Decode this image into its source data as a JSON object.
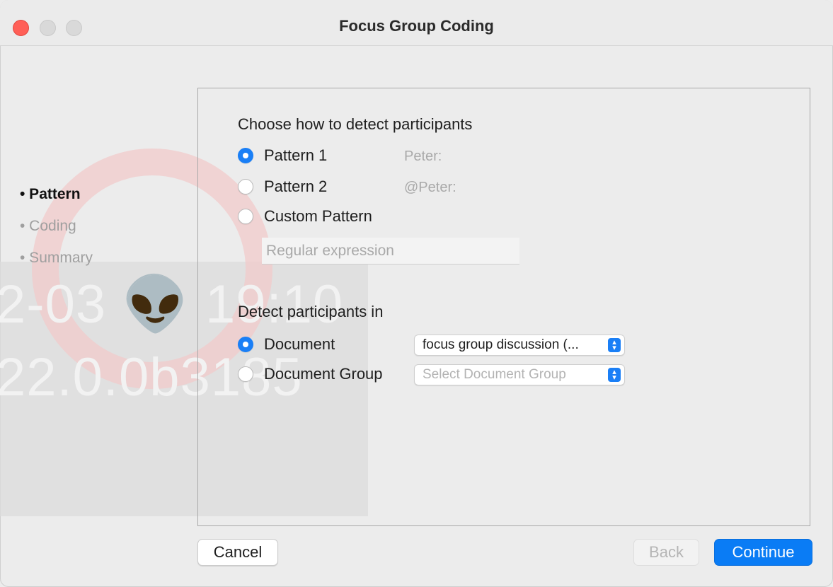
{
  "window": {
    "title": "Focus Group Coding"
  },
  "background": {
    "line1": "2-03 👽 19:10",
    "line2": "22.0.0b3185"
  },
  "steps": [
    {
      "label": "• Pattern",
      "active": true
    },
    {
      "label": "• Coding",
      "active": false
    },
    {
      "label": "• Summary",
      "active": false
    }
  ],
  "detect_pattern": {
    "heading": "Choose how to detect participants",
    "options": [
      {
        "label": "Pattern 1",
        "example": "Peter:",
        "selected": true
      },
      {
        "label": "Pattern 2",
        "example": "@Peter:",
        "selected": false
      },
      {
        "label": "Custom Pattern",
        "example": "",
        "selected": false
      }
    ],
    "regex_placeholder": "Regular expression"
  },
  "detect_in": {
    "heading": "Detect participants in",
    "options": [
      {
        "label": "Document",
        "selected": true,
        "popup_value": "focus group discussion (...",
        "popup_enabled": true
      },
      {
        "label": "Document Group",
        "selected": false,
        "popup_value": "Select Document Group",
        "popup_enabled": false
      }
    ]
  },
  "buttons": {
    "cancel": "Cancel",
    "back": "Back",
    "continue": "Continue"
  },
  "colors": {
    "accent": "#0a7cf5",
    "close": "#ff5f57"
  }
}
